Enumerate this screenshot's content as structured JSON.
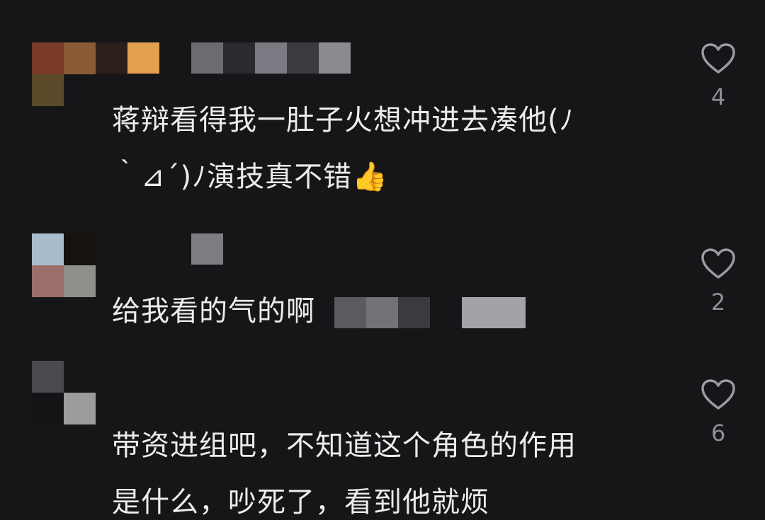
{
  "comments": [
    {
      "text_line1": "蒋辩看得我一肚子火想冲进去凑他(ﾉ",
      "text_line2": "｀⊿´)ﾉ演技真不错👍",
      "likes": "4",
      "avatar_colors": [
        "#7a3a28",
        "#8b5a36",
        "#2b201c",
        "#e3a04f",
        "#5a4a2a",
        "#161618"
      ],
      "name_colors": [
        "#6b6b72",
        "#2a2a30",
        "#7a7a82",
        "#3a3a40",
        "#8a8a90"
      ]
    },
    {
      "text_visible": "给我看的气的啊",
      "likes": "2",
      "avatar_colors": [
        "#a9bccd",
        "#151210",
        "#9a6f6a",
        "#8e8e8a"
      ],
      "name_colors": [
        "#7d7d84"
      ]
    },
    {
      "text_line1": "带资进组吧，不知道这个角色的作用",
      "text_line2": "是什么，吵死了，看到他就烦",
      "likes": "6",
      "avatar_colors": [
        "#4a4a4e",
        "#161618",
        "#141416",
        "#9c9c9e"
      ]
    }
  ],
  "censor_colors": [
    "#5a5a60",
    "#727279",
    "#3a3a40",
    "#161618",
    "#a2a2a8"
  ],
  "icons": {
    "like": "heart-outline-icon"
  }
}
